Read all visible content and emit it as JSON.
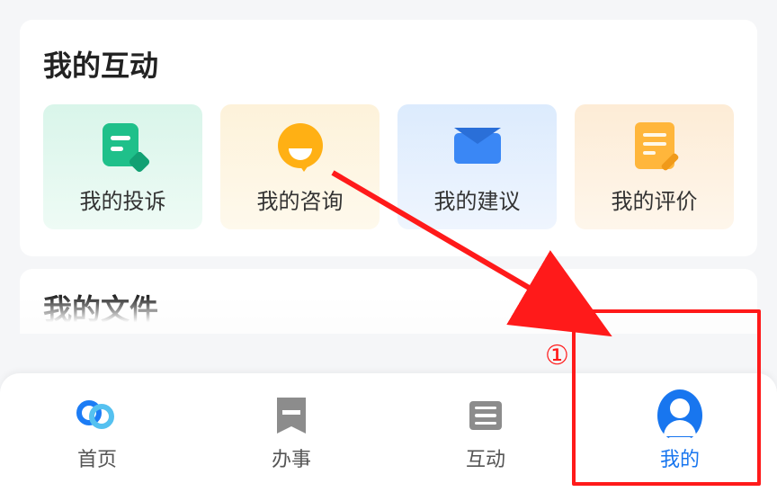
{
  "section": {
    "title": "我的互动",
    "tiles": [
      {
        "label": "我的投诉"
      },
      {
        "label": "我的咨询"
      },
      {
        "label": "我的建议"
      },
      {
        "label": "我的评价"
      }
    ]
  },
  "section2": {
    "title_partial": "我的文件"
  },
  "nav": {
    "items": [
      {
        "label": "首页"
      },
      {
        "label": "办事"
      },
      {
        "label": "互动"
      },
      {
        "label": "我的"
      }
    ]
  },
  "annotation": {
    "step_marker": "①"
  }
}
